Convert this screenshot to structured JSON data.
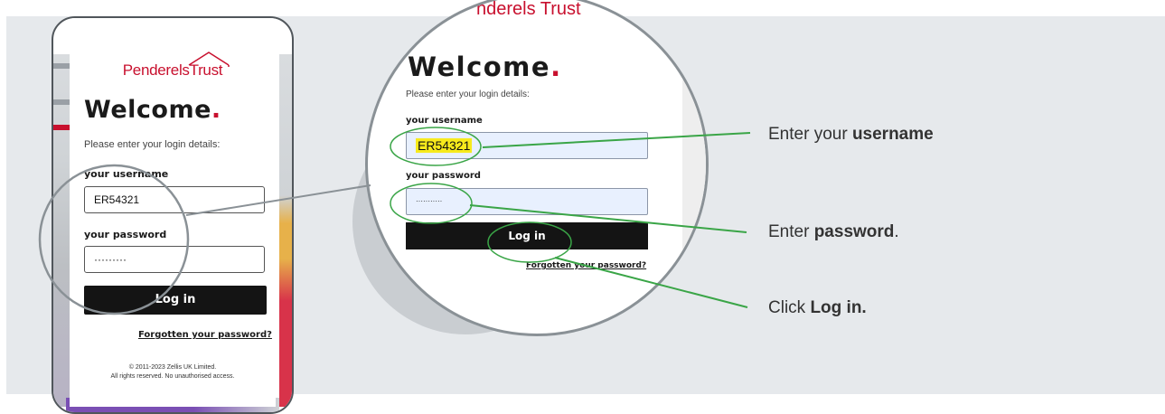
{
  "phone": {
    "logo": "PenderelsTrust",
    "welcome": "Welcome",
    "welcome_dot": ".",
    "subtitle": "Please enter your login details:",
    "username_label": "your username",
    "username_value": "ER54321",
    "password_label": "your password",
    "password_value": "·········",
    "login_button": "Log in",
    "forgot_link": "Forgotten your password?",
    "copyright_line1": "© 2011-2023 Zellis UK Limited.",
    "copyright_line2": "All rights reserved. No unauthorised access."
  },
  "zoom": {
    "logo": "nderels Trust",
    "welcome": "Welcome",
    "welcome_dot": ".",
    "subtitle": "Please enter your login details:",
    "username_label": "your username",
    "username_value": "ER54321",
    "password_label": "your password",
    "password_value": "···········",
    "login_button": "Log in",
    "forgot_link": "Forgotten your password?"
  },
  "callouts": {
    "username_prefix": "Enter your ",
    "username_bold": "username",
    "password_prefix": "Enter ",
    "password_bold": "password",
    "password_suffix": ".",
    "login_prefix": "Click ",
    "login_bold": "Log in."
  },
  "colors": {
    "brand_red": "#c8102e",
    "callout_green": "#3aa547",
    "highlight_yellow": "#f7ea1c",
    "panel_bg": "#e6e9ec"
  }
}
